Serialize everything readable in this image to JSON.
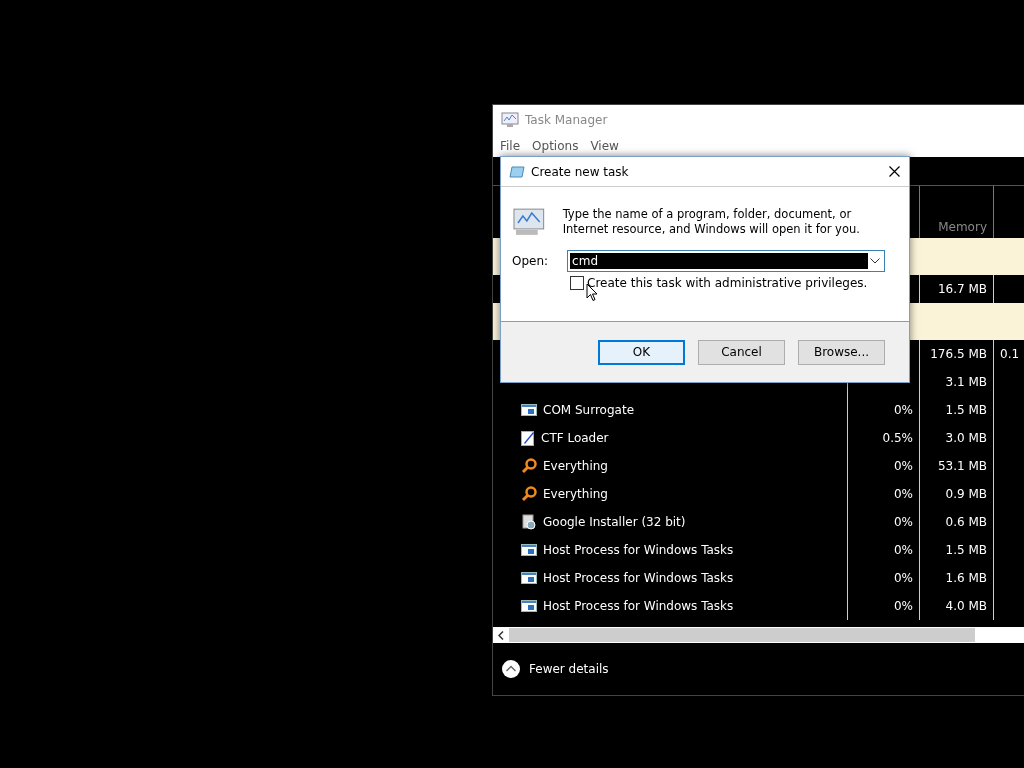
{
  "task_manager": {
    "title": "Task Manager",
    "menu": [
      "File",
      "Options",
      "View"
    ],
    "columns": {
      "memory": "Memory"
    },
    "rows": [
      {
        "kind": "group"
      },
      {
        "kind": "process",
        "memory": "16.7 MB"
      },
      {
        "kind": "group"
      },
      {
        "kind": "process",
        "memory": "176.5 MB",
        "column_4": "0.1"
      },
      {
        "kind": "process",
        "memory": "3.1 MB"
      },
      {
        "kind": "service",
        "name": "COM Surrogate",
        "cpu": "0%",
        "memory": "1.5 MB"
      },
      {
        "kind": "editor",
        "name": "CTF Loader",
        "cpu": "0.5%",
        "memory": "3.0 MB"
      },
      {
        "kind": "search",
        "name": "Everything",
        "cpu": "0%",
        "memory": "53.1 MB"
      },
      {
        "kind": "search",
        "name": "Everything",
        "cpu": "0%",
        "memory": "0.9 MB"
      },
      {
        "kind": "installer",
        "name": "Google Installer (32 bit)",
        "cpu": "0%",
        "memory": "0.6 MB"
      },
      {
        "kind": "service",
        "name": "Host Process for Windows Tasks",
        "cpu": "0%",
        "memory": "1.5 MB"
      },
      {
        "kind": "service",
        "name": "Host Process for Windows Tasks",
        "cpu": "0%",
        "memory": "1.6 MB"
      },
      {
        "kind": "service",
        "name": "Host Process for Windows Tasks",
        "cpu": "0%",
        "memory": "4.0 MB"
      }
    ],
    "footer": "Fewer details"
  },
  "dialog": {
    "title": "Create new task",
    "message": "Type the name of a program, folder, document, or Internet resource, and Windows will open it for you.",
    "open_label": "Open:",
    "value": "cmd",
    "admin_checkbox": {
      "label": "Create this task with administrative privileges.",
      "checked": false
    },
    "buttons": [
      {
        "label": "OK",
        "default": true
      },
      {
        "label": "Cancel",
        "default": false
      },
      {
        "label": "Browse...",
        "default": false
      }
    ]
  }
}
